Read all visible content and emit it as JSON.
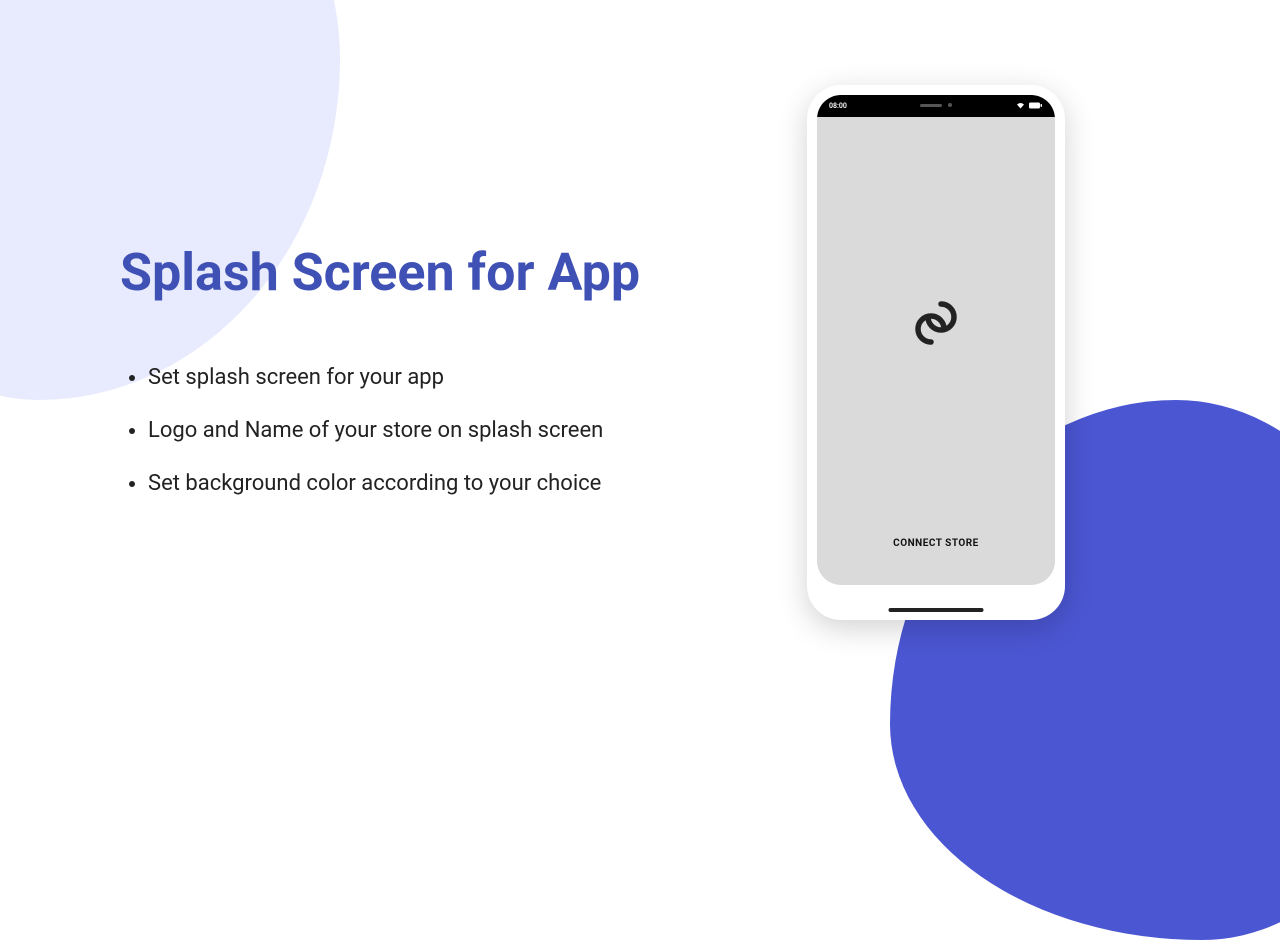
{
  "heading": "Splash Screen for App",
  "bullets": [
    "Set splash screen for your app",
    "Logo and Name of your store on splash screen",
    "Set background color according to your choice"
  ],
  "phone": {
    "time": "08:00",
    "store_name": "CONNECT STORE"
  },
  "colors": {
    "accent": "#3f51b5",
    "blob_light": "#e8eafd",
    "blob_dark": "#4b56d2"
  }
}
